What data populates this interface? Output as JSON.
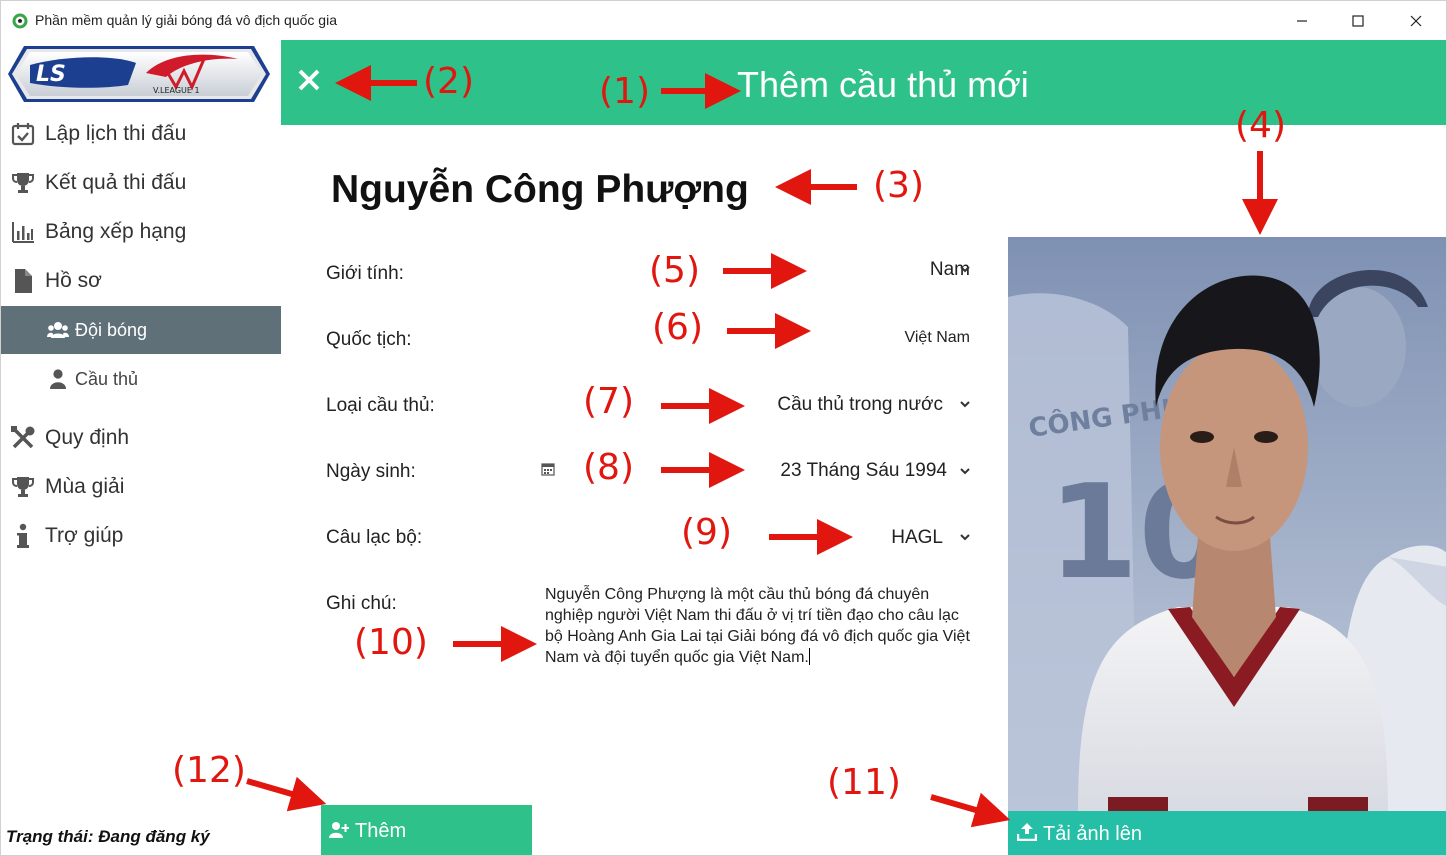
{
  "window": {
    "title": "Phần mềm quản lý giải bóng đá vô địch quốc gia"
  },
  "logo": {
    "ls": "LS",
    "vleague": "V.LEAGUE 1"
  },
  "sidebar": {
    "items": [
      {
        "label": "Lập lịch thi đấu",
        "icon": "calendar-check-icon"
      },
      {
        "label": "Kết quả thi đấu",
        "icon": "trophy-icon"
      },
      {
        "label": "Bảng xếp hạng",
        "icon": "bar-chart-icon"
      },
      {
        "label": "Hồ sơ",
        "icon": "file-icon"
      },
      {
        "label": "Quy định",
        "icon": "tools-icon"
      },
      {
        "label": "Mùa giải",
        "icon": "trophy-icon"
      },
      {
        "label": "Trợ giúp",
        "icon": "info-icon"
      }
    ],
    "subitems": [
      {
        "label": "Đội bóng",
        "icon": "users-icon",
        "active": true
      },
      {
        "label": "Cầu thủ",
        "icon": "user-icon",
        "active": false
      }
    ]
  },
  "status": "Trạng thái: Đang đăng ký",
  "header": {
    "title": "Thêm cầu thủ mới",
    "color": "#2ec28a"
  },
  "player": {
    "name": "Nguyễn Công Phượng"
  },
  "form": {
    "gender": {
      "label": "Giới tính:",
      "value": "Nam"
    },
    "nationality": {
      "label": "Quốc tịch:",
      "value": "Việt Nam"
    },
    "player_type": {
      "label": "Loại cầu thủ:",
      "value": "Cầu thủ trong nước"
    },
    "birthday": {
      "label": "Ngày sinh:",
      "value": "23 Tháng Sáu 1994"
    },
    "club": {
      "label": "Câu lạc bộ:",
      "value": "HAGL"
    },
    "notes": {
      "label": "Ghi chú:",
      "value": "Nguyễn Công Phượng là một cầu thủ bóng đá chuyên nghiệp người Việt Nam thi đấu ở vị trí tiền đạo cho câu lạc bộ Hoàng Anh Gia Lai tại Giải bóng đá vô địch quốc gia Việt Nam và đội tuyển quốc gia Việt Nam."
    }
  },
  "buttons": {
    "upload": "Tải ảnh lên",
    "add": "Thêm"
  },
  "photo": {
    "jersey_text": "CÔNG PHƯỢNG",
    "jersey_number": "10"
  },
  "annotations": [
    "(1)",
    "(2)",
    "(3)",
    "(4)",
    "(5)",
    "(6)",
    "(7)",
    "(8)",
    "(9)",
    "(10)",
    "(11)",
    "(12)"
  ]
}
